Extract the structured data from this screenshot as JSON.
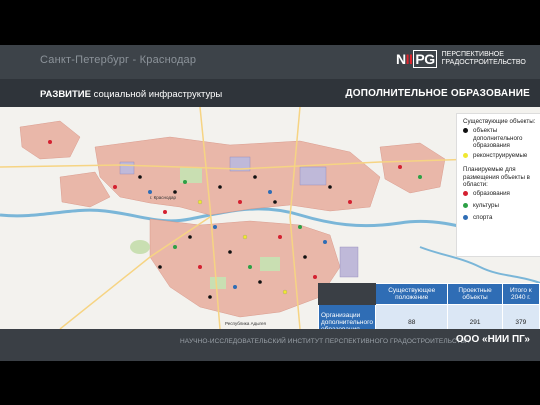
{
  "header": {
    "city": "Санкт-Петербург - Краснодар",
    "logo_mark": "NIIPG",
    "logo_text": "ПЕРСПЕКТИВНОЕ ГРАДОСТРОИТЕЛЬСТВО"
  },
  "title": {
    "prefix": "РАЗВИТИЕ",
    "rest": " социальной инфраструктуры",
    "right": "ДОПОЛНИТЕЛЬНОЕ ОБРАЗОВАНИЕ"
  },
  "map": {
    "labels": [
      "г. Краснодар",
      "Республика Адыгея"
    ]
  },
  "legend": {
    "existing_header": "Существующие объекты:",
    "existing_items": [
      {
        "label": "объекты дополнительного образования",
        "color": "#111111"
      },
      {
        "label": "реконструируемые",
        "color": "#f0e832"
      }
    ],
    "planned_header": "Планируемые для размещения объекты в области:",
    "planned_items": [
      {
        "label": "образования",
        "color": "#d42030"
      },
      {
        "label": "культуры",
        "color": "#2da046"
      },
      {
        "label": "спорта",
        "color": "#2f6db5"
      }
    ]
  },
  "table": {
    "headers": [
      "Существующее положение",
      "Проектные объекты",
      "Итого к 2040 г."
    ],
    "row_label": "Организации дополнительного образования",
    "values": [
      "88",
      "291",
      "379"
    ]
  },
  "footer": {
    "left": "НАУЧНО-ИССЛЕДОВАТЕЛЬСКИЙ ИНСТИТУТ ПЕРСПЕКТИВНОГО ГРАДОСТРОИТЕЛЬСТВА",
    "right": "ООО «НИИ ПГ»"
  }
}
